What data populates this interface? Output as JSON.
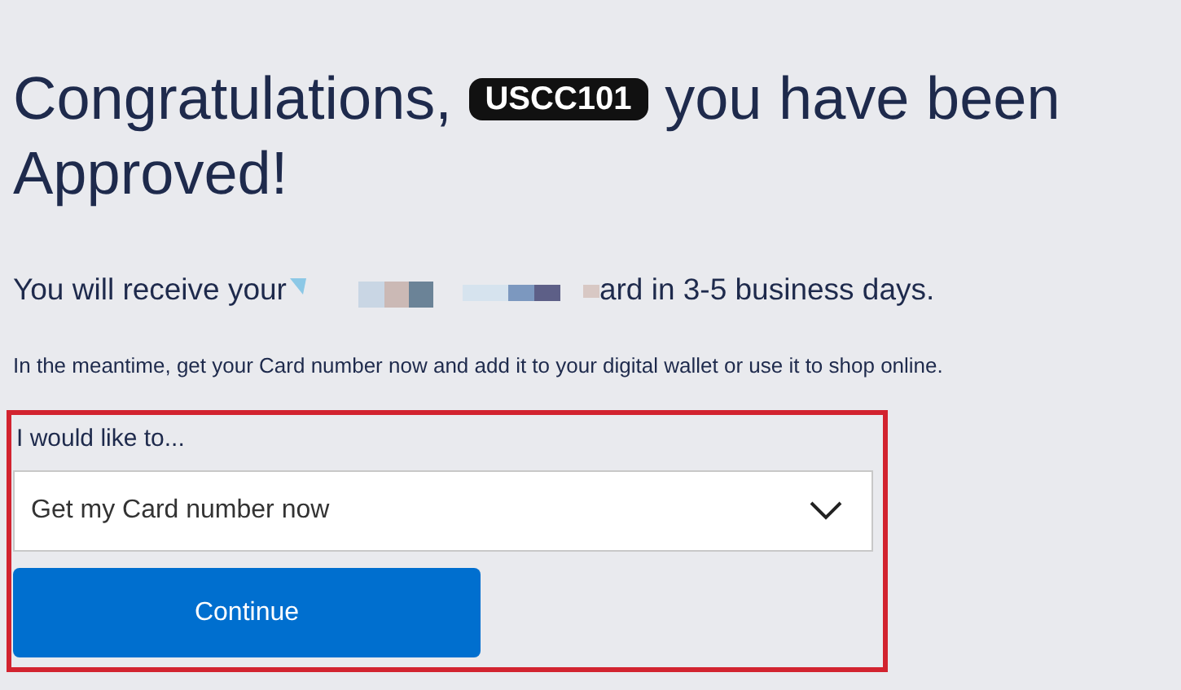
{
  "heading": {
    "before": "Congratulations,",
    "label": "USCC101",
    "after_lines": [
      "you have been",
      "Approved!"
    ]
  },
  "delivery": {
    "before": "You will receive your",
    "after": "ard in 3-5 business days."
  },
  "note": "In the meantime, get your Card number now and add it to your digital wallet or use it to shop online.",
  "form": {
    "highlighted": true,
    "label": "I would like to...",
    "select_value": "Get my Card number now",
    "button": "Continue"
  }
}
